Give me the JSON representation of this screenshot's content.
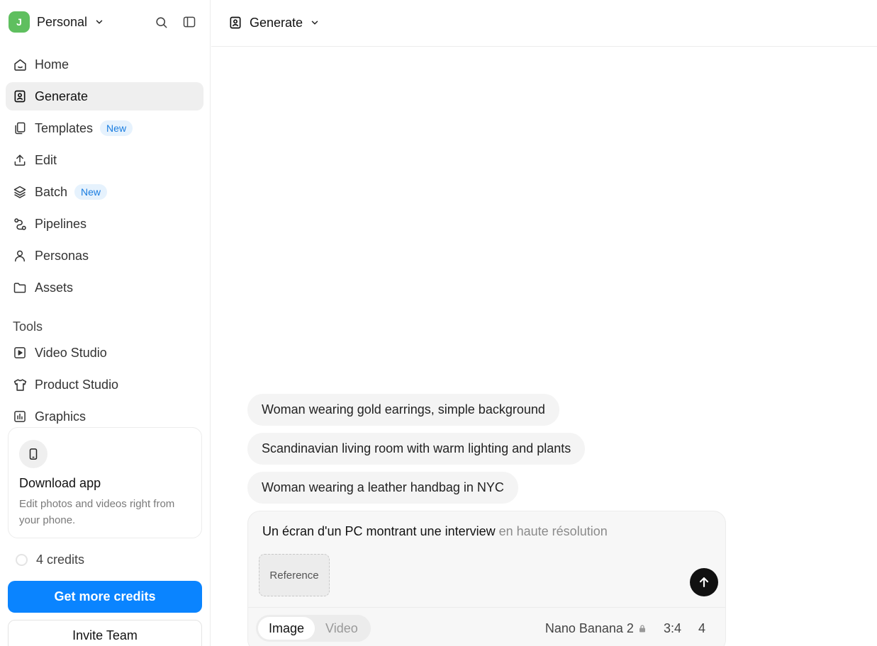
{
  "workspace": {
    "avatar_letter": "J",
    "name": "Personal"
  },
  "sidebar": {
    "items": [
      {
        "label": "Home"
      },
      {
        "label": "Generate"
      },
      {
        "label": "Templates",
        "badge": "New"
      },
      {
        "label": "Edit"
      },
      {
        "label": "Batch",
        "badge": "New"
      },
      {
        "label": "Pipelines"
      },
      {
        "label": "Personas"
      },
      {
        "label": "Assets"
      }
    ],
    "tools_title": "Tools",
    "tools": [
      {
        "label": "Video Studio"
      },
      {
        "label": "Product Studio"
      },
      {
        "label": "Graphics"
      }
    ],
    "active_item": "Generate"
  },
  "app_card": {
    "title": "Download app",
    "description": "Edit photos and videos right from your phone."
  },
  "credits": {
    "text": "4 credits"
  },
  "buttons": {
    "get_credits": "Get more credits",
    "invite_team": "Invite Team"
  },
  "header": {
    "mode_label": "Generate"
  },
  "suggestions": [
    "Woman wearing gold earrings, simple background",
    "Scandinavian living room with warm lighting and plants",
    "Woman wearing a leather handbag in NYC"
  ],
  "composer": {
    "prompt_text": "Un écran d'un PC montrant une interview",
    "prompt_suggestion": " en haute résolution",
    "reference_label": "Reference",
    "media_options": [
      "Image",
      "Video"
    ],
    "selected_media": "Image",
    "model": "Nano Banana 2",
    "aspect_ratio": "3:4",
    "count": "4"
  },
  "colors": {
    "accent": "#0a84ff",
    "avatar": "#5fbf5f",
    "badge_text": "#1a7de0",
    "badge_bg": "#e6f2fd"
  }
}
